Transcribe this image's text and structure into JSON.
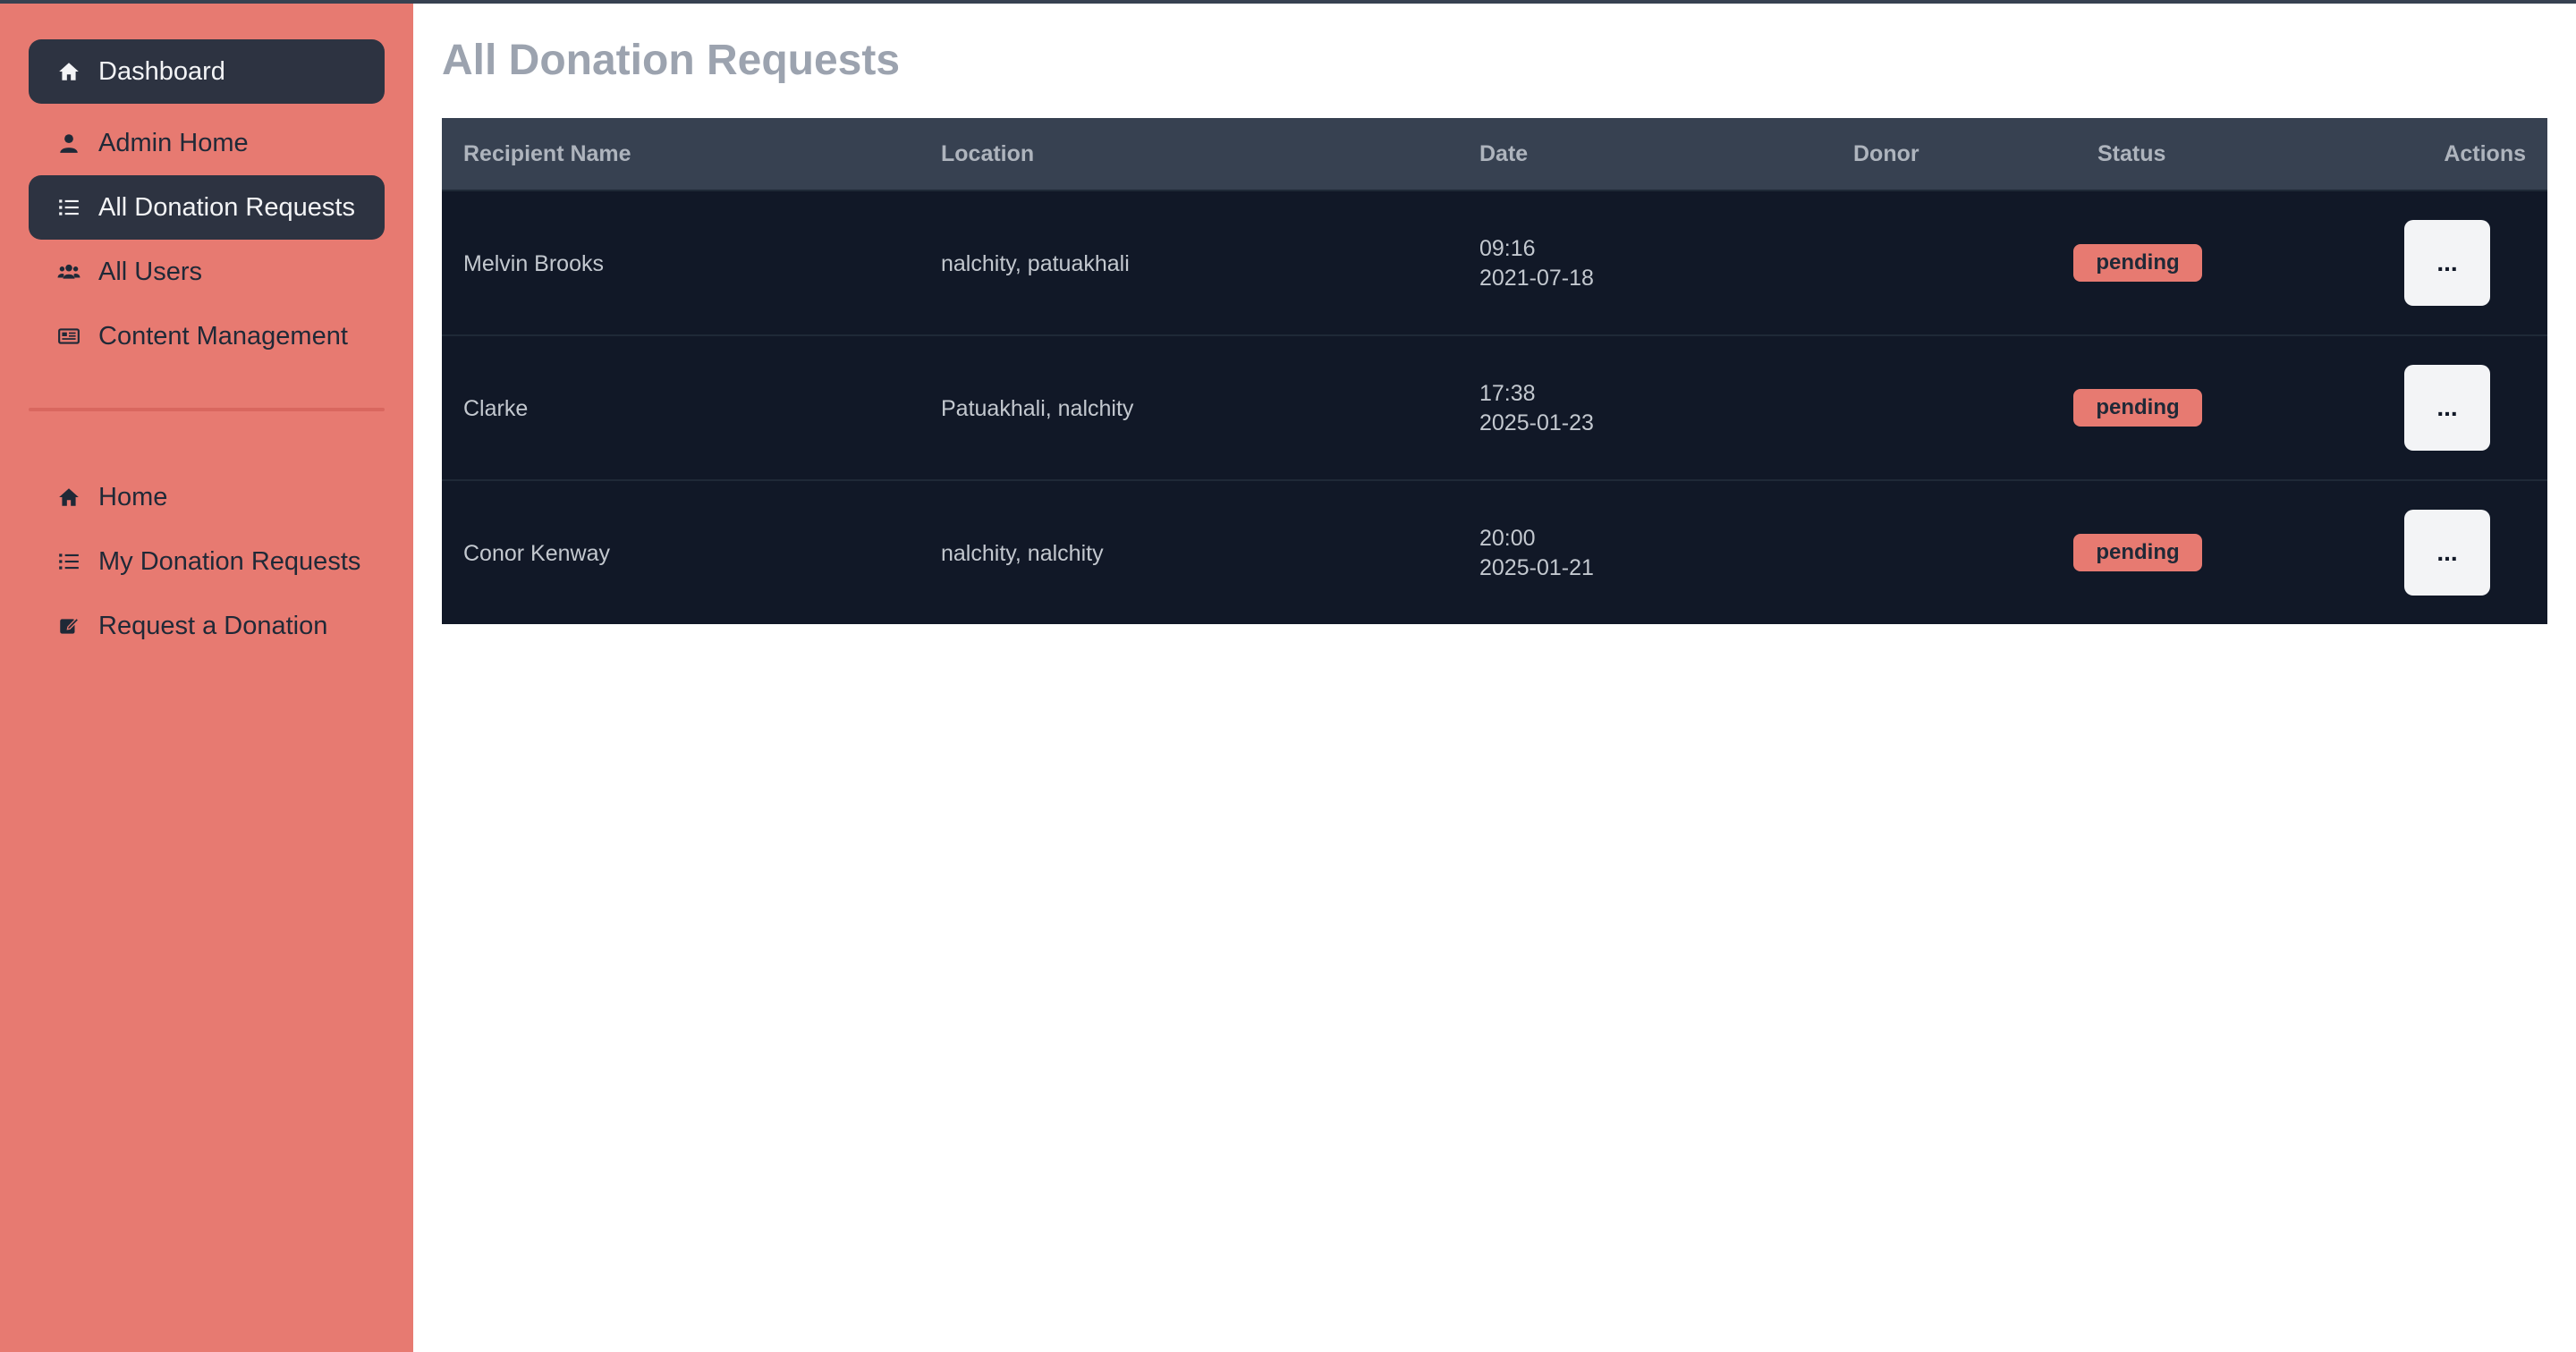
{
  "sidebar": {
    "admin_items": [
      {
        "label": "Dashboard",
        "icon": "home-icon",
        "active": true
      },
      {
        "label": "Admin Home",
        "icon": "user-icon",
        "active": false
      },
      {
        "label": "All Donation Requests",
        "icon": "list-icon",
        "active": true
      },
      {
        "label": "All Users",
        "icon": "users-icon",
        "active": false
      },
      {
        "label": "Content Management",
        "icon": "newspaper-icon",
        "active": false
      }
    ],
    "user_items": [
      {
        "label": "Home",
        "icon": "home-icon"
      },
      {
        "label": "My Donation Requests",
        "icon": "list-icon"
      },
      {
        "label": "Request a Donation",
        "icon": "edit-icon"
      }
    ]
  },
  "main": {
    "title": "All Donation Requests",
    "table": {
      "headers": [
        "Recipient Name",
        "Location",
        "Date",
        "Donor",
        "Status",
        "Actions"
      ],
      "rows": [
        {
          "recipient": "Melvin Brooks",
          "location": "nalchity, patuakhali",
          "time": "09:16",
          "date": "2021-07-18",
          "donor": "",
          "status": "pending",
          "action": "..."
        },
        {
          "recipient": "Clarke",
          "location": "Patuakhali, nalchity",
          "time": "17:38",
          "date": "2025-01-23",
          "donor": "",
          "status": "pending",
          "action": "..."
        },
        {
          "recipient": "Conor Kenway",
          "location": "nalchity, nalchity",
          "time": "20:00",
          "date": "2025-01-21",
          "donor": "",
          "status": "pending",
          "action": "..."
        }
      ]
    }
  },
  "colors": {
    "sidebar_bg": "#e77a71",
    "active_item_bg": "#2d3341",
    "table_bg": "#111827",
    "table_header_bg": "#374151",
    "badge_bg": "#e77a71"
  }
}
